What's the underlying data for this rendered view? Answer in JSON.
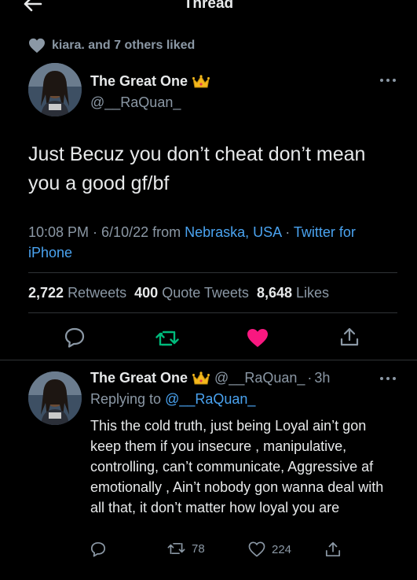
{
  "header": {
    "title": "Thread"
  },
  "liked_by": {
    "text": "kiara. and 7 others liked"
  },
  "tweet": {
    "author_name": "The Great One",
    "handle": "@__RaQuan_",
    "text": "Just Becuz you don’t cheat don’t mean you a good gf/bf",
    "time": "10:08 PM",
    "date": "6/10/22",
    "from_label": "from",
    "location": "Nebraska, USA",
    "source": "Twitter for iPhone",
    "retweets_count": "2,722",
    "retweets_label": "Retweets",
    "quotes_count": "400",
    "quotes_label": "Quote Tweets",
    "likes_count": "8,648",
    "likes_label": "Likes"
  },
  "reply": {
    "author_name": "The Great One",
    "handle": "@__RaQuan_",
    "age": "3h",
    "replying_label": "Replying to",
    "replying_to": "@__RaQuan_",
    "text": "This the cold truth,  just being Loyal ain’t gon keep them if you insecure , manipulative, controlling, can’t communicate, Aggressive af emotionally , Ain’t nobody gon wanna deal with all that, it don’t matter how loyal you are",
    "retweets": "78",
    "likes": "224"
  },
  "colors": {
    "link": "#4aa3f0",
    "retweet_green": "#00ba7c",
    "like_pink": "#f91880",
    "muted": "#8b98a5"
  },
  "icons": [
    "back-arrow-icon",
    "heart-icon",
    "crown-emoji-icon",
    "more-icon",
    "reply-icon",
    "retweet-icon",
    "like-icon",
    "share-icon"
  ]
}
